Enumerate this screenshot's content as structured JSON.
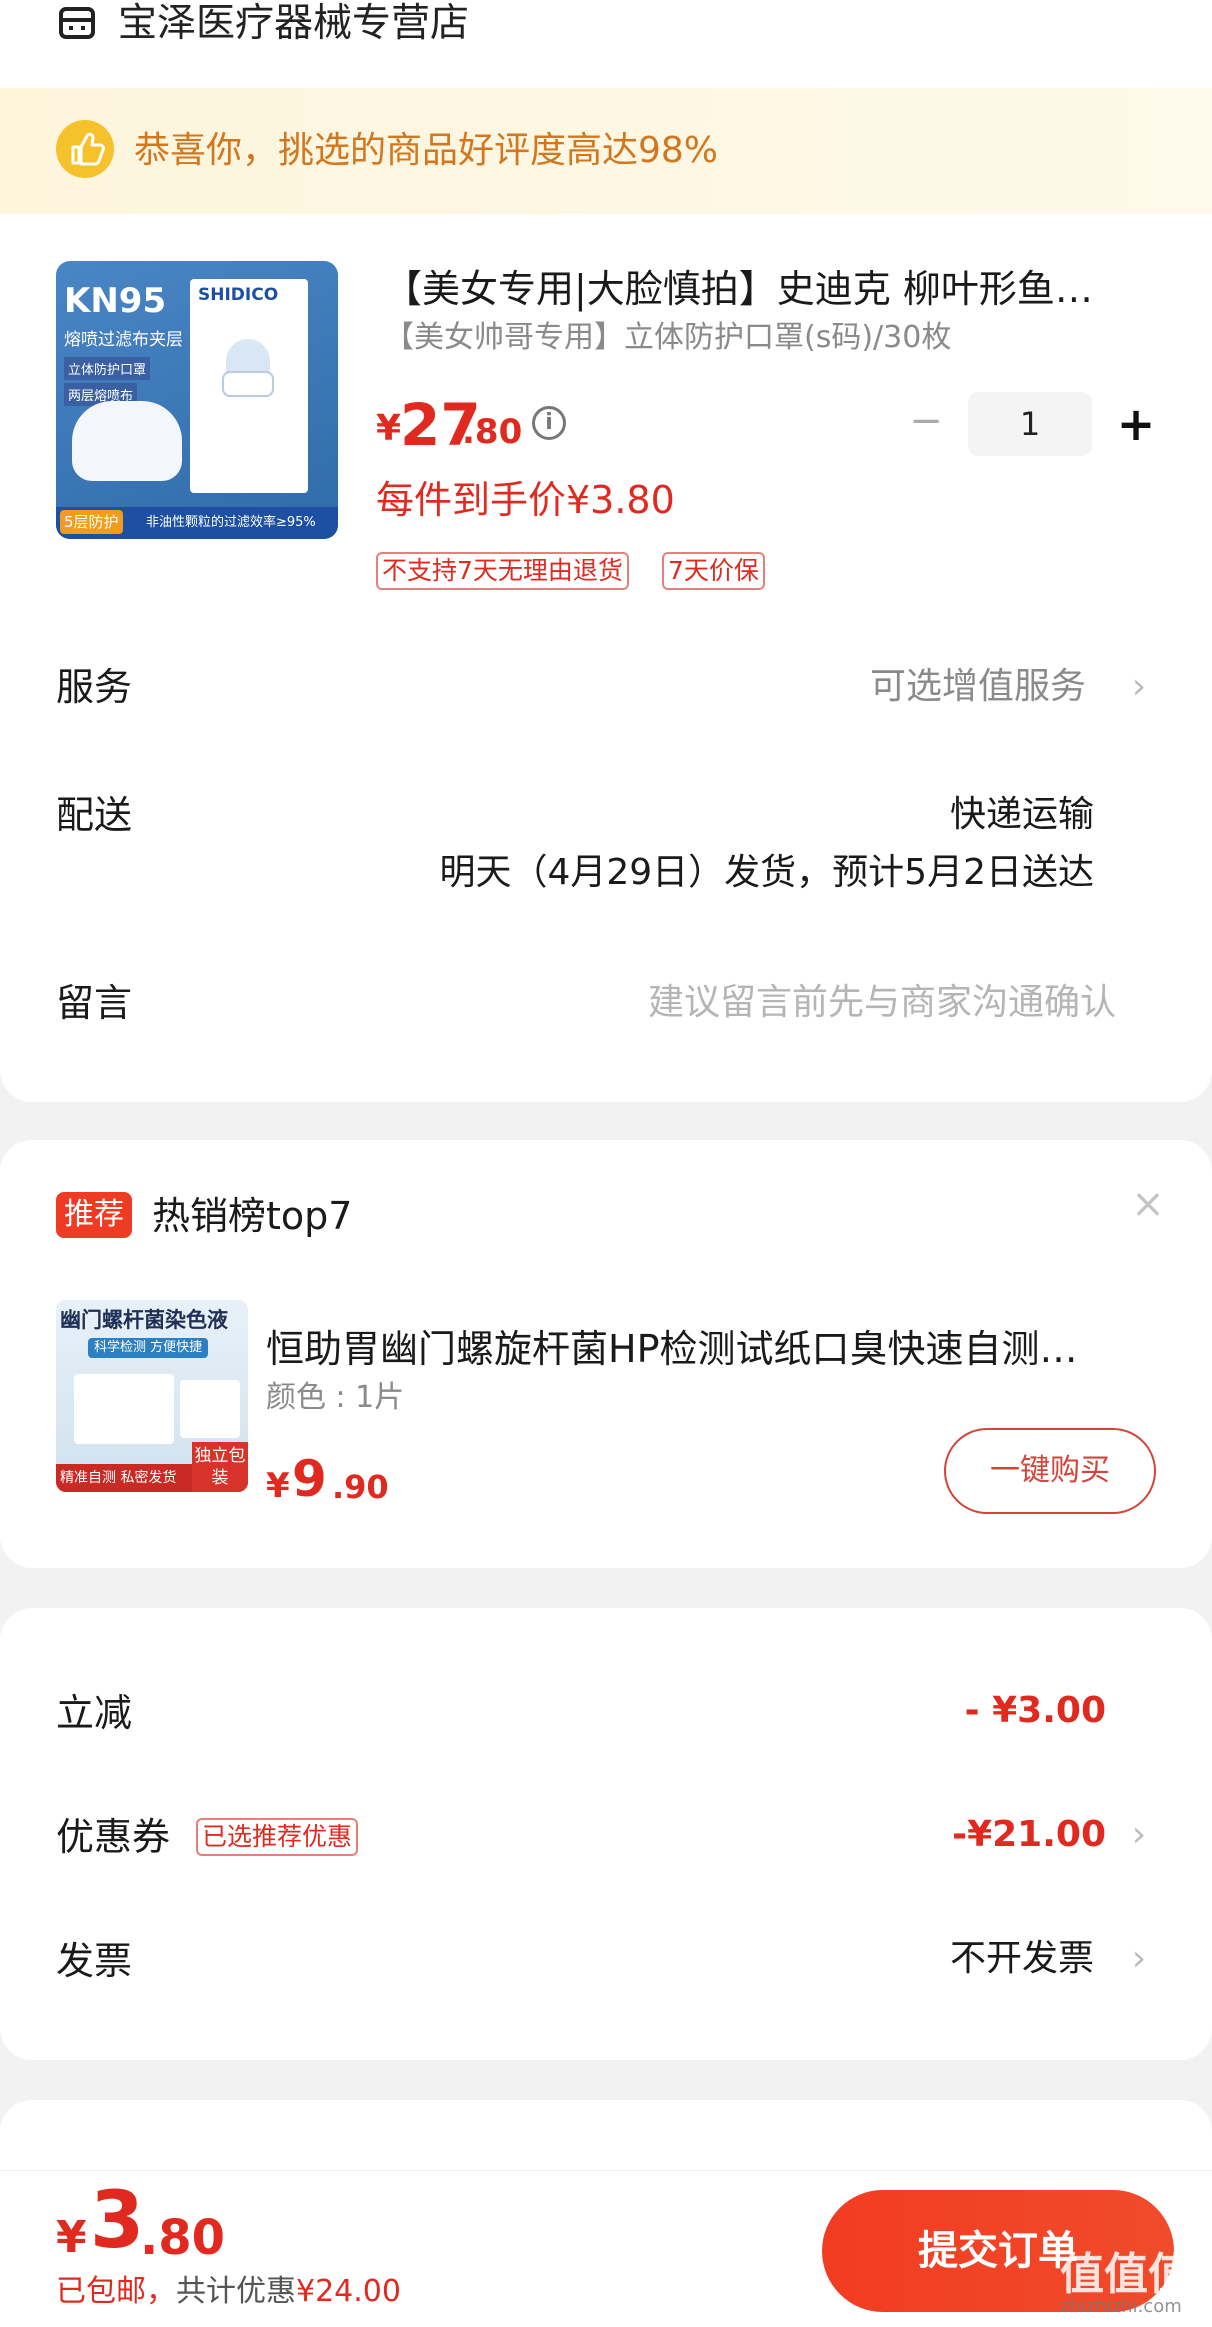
{
  "shop": {
    "name": "宝泽医疗器械专营店"
  },
  "banner": {
    "text": "恭喜你，挑选的商品好评度高达98%"
  },
  "product": {
    "title": "【美女专用|大脸慎拍】史迪克 柳叶形鱼…",
    "spec": "【美女帅哥专用】立体防护口罩(s码)/30枚",
    "price_yen": "¥",
    "price_int": "27",
    "price_dec": ".80",
    "quantity": "1",
    "per_price": "每件到手价¥3.80",
    "tags": [
      "不支持7天无理由退货",
      "7天价保"
    ],
    "image_text": {
      "kn95": "KN95",
      "sub": "熔喷过滤布夹层",
      "l1": "立体防护口罩",
      "l2": "两层熔喷布",
      "brand": "SHIDICO",
      "bottom_left": "5层防护",
      "bottom_right": "非油性颗粒的过滤效率≥95%"
    }
  },
  "service": {
    "label": "服务",
    "value": "可选增值服务"
  },
  "delivery": {
    "label": "配送",
    "method": "快递运输",
    "detail": "明天（4月29日）发货，预计5月2日送达"
  },
  "message": {
    "label": "留言",
    "placeholder": "建议留言前先与商家沟通确认"
  },
  "recommend": {
    "badge": "推荐",
    "title": "热销榜top7",
    "name": "恒助胃幽门螺旋杆菌HP检测试纸口臭快速自测…",
    "color": "颜色 : 1片",
    "price_yen": "¥",
    "price_int": "9",
    "price_dec": ".90",
    "buy_label": "一键购买",
    "image_text": {
      "top": "幽门螺杆菌染色液",
      "sub": "科学检测 方便快捷",
      "bottom": "精准自测 私密发货",
      "corner": "独立包装"
    }
  },
  "discounts": {
    "instant": {
      "label": "立减",
      "value": "- ¥3.00"
    },
    "coupon": {
      "label": "优惠券",
      "tag": "已选推荐优惠",
      "value": "-¥21.00"
    },
    "invoice": {
      "label": "发票",
      "value": "不开发票"
    }
  },
  "bottom_bar": {
    "price_yen": "¥",
    "price_int": "3",
    "price_dec": ".80",
    "note_shipping": "已包邮，",
    "note_total": "共计优惠",
    "note_amount": "¥24.00",
    "submit_label": "提交订单",
    "watermark": "值值值",
    "watermark_sub": "zhizhizhi.com"
  },
  "colors": {
    "accent": "#e12a1f",
    "banner_text": "#d2771e",
    "submit_bg": "#f23c22"
  }
}
